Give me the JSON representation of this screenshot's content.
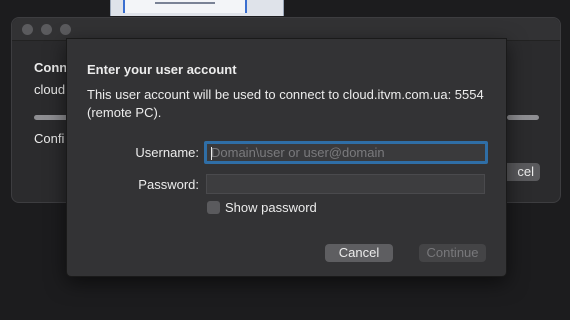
{
  "background_window": {
    "title": "Conn",
    "host": "cloud",
    "status": "Confi",
    "cancel_label": "cel"
  },
  "dialog": {
    "title": "Enter your user account",
    "message": "This user account will be used to connect to cloud.itvm.com.ua: 5554 (remote PC).",
    "username": {
      "label": "Username:",
      "value": "",
      "placeholder": "Domain\\user or user@domain"
    },
    "password": {
      "label": "Password:",
      "value": ""
    },
    "show_password": {
      "label": "Show password",
      "checked": false
    },
    "buttons": {
      "cancel": "Cancel",
      "continue": "Continue"
    }
  },
  "colors": {
    "focus_ring": "#2f6ea6",
    "sheet_bg": "#333335",
    "window_bg": "#2b2b2d"
  }
}
